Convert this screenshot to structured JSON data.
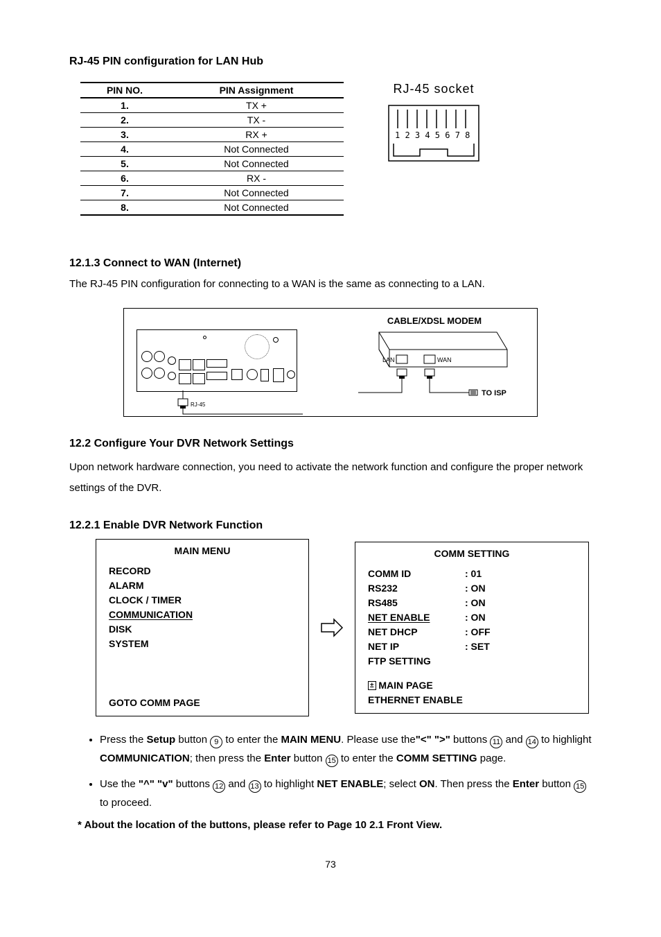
{
  "h_rj45": "RJ-45 PIN configuration for LAN Hub",
  "pin_table": {
    "h1": "PIN NO.",
    "h2": "PIN Assignment",
    "rows": [
      {
        "n": "1.",
        "a": "TX +"
      },
      {
        "n": "2.",
        "a": "TX -"
      },
      {
        "n": "3.",
        "a": "RX +"
      },
      {
        "n": "4.",
        "a": "Not Connected"
      },
      {
        "n": "5.",
        "a": "Not Connected"
      },
      {
        "n": "6.",
        "a": "RX -"
      },
      {
        "n": "7.",
        "a": "Not Connected"
      },
      {
        "n": "8.",
        "a": "Not Connected"
      }
    ]
  },
  "socket_label": "RJ-45 socket",
  "h_1213": "12.1.3   Connect to WAN (Internet)",
  "wan_text": "The RJ-45 PIN configuration for connecting to a WAN is the same as connecting to a LAN.",
  "diagram": {
    "modem_title": "CABLE/XDSL MODEM",
    "lan": "LAN",
    "wan": "WAN",
    "to_isp": "TO ISP",
    "rj45": "RJ-45"
  },
  "h_122": "12.2 Configure Your DVR Network Settings",
  "p122": "Upon network hardware connection, you need to activate the network function and configure the proper network settings of the DVR.",
  "h_1221": "12.2.1 Enable DVR Network Function",
  "main_menu": {
    "title": "MAIN MENU",
    "items": [
      "RECORD",
      "ALARM",
      "CLOCK / TIMER",
      "COMMUNICATION",
      "DISK",
      "SYSTEM"
    ],
    "goto": "GOTO COMM PAGE"
  },
  "comm_menu": {
    "title": "COMM SETTING",
    "rows": [
      {
        "k": "COMM   ID",
        "v": ": 01"
      },
      {
        "k": "RS232",
        "v": ": ON"
      },
      {
        "k": "RS485",
        "v": ": ON"
      },
      {
        "k": "NET ENABLE",
        "v": ": ON",
        "u": true
      },
      {
        "k": "NET DHCP",
        "v": ": OFF"
      },
      {
        "k": "NET IP",
        "v": ": SET"
      },
      {
        "k": "FTP SETTING",
        "v": ""
      }
    ],
    "main_page": "MAIN PAGE",
    "eth_enable": "ETHERNET   ENABLE"
  },
  "bullets": {
    "b1a": "Press the ",
    "b1b": "Setup",
    "b1c": " button ",
    "b1d": "9",
    "b1e": " to enter the ",
    "b1f": "MAIN MENU",
    "b1g": ". Please use the",
    "b1h": "\"<\" \">\"",
    "b1i": " buttons ",
    "b1j": "11",
    "b1k": " and ",
    "b1l": "14",
    "b1m": " to highlight ",
    "b1n": "COMMUNICATION",
    "b1o": "; then press the ",
    "b1p": "Enter",
    "b1q": " button ",
    "b1r": "15",
    "b1s": " to enter the ",
    "b1t": "COMM SETTING",
    "b1u": " page.",
    "b2a": "Use the ",
    "b2b": "\"^\" \"v\"",
    "b2c": " buttons ",
    "b2d": "12",
    "b2e": " and ",
    "b2f": "13",
    "b2g": " to highlight ",
    "b2h": "NET ENABLE",
    "b2i": "; select ",
    "b2j": "ON",
    "b2k": ". Then press the ",
    "b2l": "Enter",
    "b2m": " button ",
    "b2n": "15",
    "b2o": " to proceed."
  },
  "footnote": "* About the location of the buttons, please refer to Page 10 2.1 Front View.",
  "page_num": "73"
}
